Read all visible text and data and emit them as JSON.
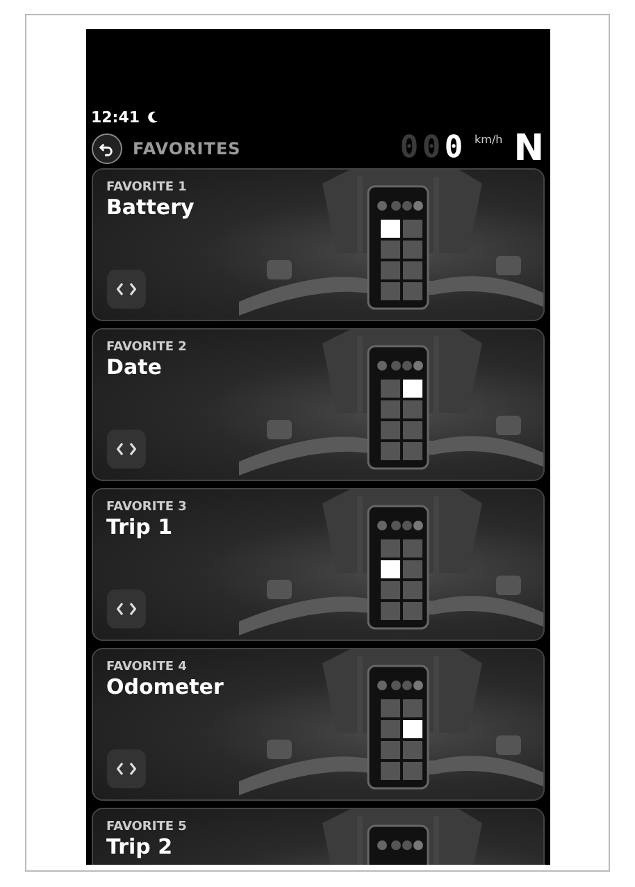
{
  "status_bar": {
    "time": "12:41"
  },
  "header": {
    "title": "FAVORITES",
    "speed_digits": [
      {
        "text": "0",
        "lit": false
      },
      {
        "text": "0",
        "lit": false
      },
      {
        "text": "0",
        "lit": true
      }
    ],
    "speed_unit": "km/h",
    "gear": "N"
  },
  "favorites": [
    {
      "label": "FAVORITE 1",
      "value": "Battery",
      "tiles": [
        {
          "highlighted": true
        },
        {
          "highlighted": false
        },
        {
          "highlighted": false
        },
        {
          "highlighted": false
        },
        {
          "highlighted": false
        },
        {
          "highlighted": false
        },
        {
          "highlighted": false
        },
        {
          "highlighted": false
        }
      ]
    },
    {
      "label": "FAVORITE 2",
      "value": "Date",
      "tiles": [
        {
          "highlighted": false
        },
        {
          "highlighted": true
        },
        {
          "highlighted": false
        },
        {
          "highlighted": false
        },
        {
          "highlighted": false
        },
        {
          "highlighted": false
        },
        {
          "highlighted": false
        },
        {
          "highlighted": false
        }
      ]
    },
    {
      "label": "FAVORITE 3",
      "value": "Trip 1",
      "tiles": [
        {
          "highlighted": false
        },
        {
          "highlighted": false
        },
        {
          "highlighted": true
        },
        {
          "highlighted": false
        },
        {
          "highlighted": false
        },
        {
          "highlighted": false
        },
        {
          "highlighted": false
        },
        {
          "highlighted": false
        }
      ]
    },
    {
      "label": "FAVORITE 4",
      "value": "Odometer",
      "tiles": [
        {
          "highlighted": false
        },
        {
          "highlighted": false
        },
        {
          "highlighted": false
        },
        {
          "highlighted": true
        },
        {
          "highlighted": false
        },
        {
          "highlighted": false
        },
        {
          "highlighted": false
        },
        {
          "highlighted": false
        }
      ]
    },
    {
      "label": "FAVORITE 5",
      "value": "Trip 2"
    }
  ]
}
